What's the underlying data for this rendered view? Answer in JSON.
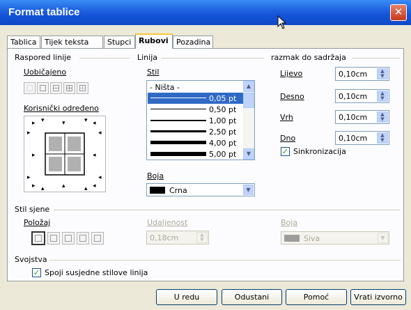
{
  "window": {
    "title": "Format tablice"
  },
  "tabs": [
    {
      "label": "Tablica"
    },
    {
      "label": "Tijek teksta"
    },
    {
      "label": "Stupci"
    },
    {
      "label": "Rubovi"
    },
    {
      "label": "Pozadina"
    }
  ],
  "line_arrangement": {
    "group_label": "Raspored linije",
    "default_label": "Uobičajeno",
    "user_defined_label": "Korisnički određeno"
  },
  "line": {
    "group_label": "Linija",
    "style_label": "Stil",
    "styles": [
      {
        "label": "- Ništa -"
      },
      {
        "label": "0,05 pt"
      },
      {
        "label": "0,50 pt"
      },
      {
        "label": "1,00 pt"
      },
      {
        "label": "2,50 pt"
      },
      {
        "label": "4,00 pt"
      },
      {
        "label": "5,00 pt"
      }
    ],
    "selected_style": "0,05 pt",
    "color_label": "Boja",
    "color_value": "Crna",
    "color_hex": "#000000"
  },
  "spacing": {
    "group_label": "razmak do sadržaja",
    "left_label": "Lijevo",
    "left_value": "0,10cm",
    "right_label": "Desno",
    "right_value": "0,10cm",
    "top_label": "Vrh",
    "top_value": "0,10cm",
    "bottom_label": "Dno",
    "bottom_value": "0,10cm",
    "sync_label": "Sinkronizacija",
    "sync_checked": true
  },
  "shadow": {
    "group_label": "Stil sjene",
    "position_label": "Položaj",
    "distance_label": "Udaljenost",
    "distance_value": "0,18cm",
    "color_label": "Boja",
    "color_value": "Siva",
    "color_hex": "#808080"
  },
  "properties": {
    "group_label": "Svojstva",
    "merge_label": "Spoji susjedne stilove linija",
    "merge_checked": true
  },
  "buttons": {
    "ok": "U redu",
    "cancel": "Odustani",
    "help": "Pomoć",
    "reset": "Vrati izvorno"
  }
}
